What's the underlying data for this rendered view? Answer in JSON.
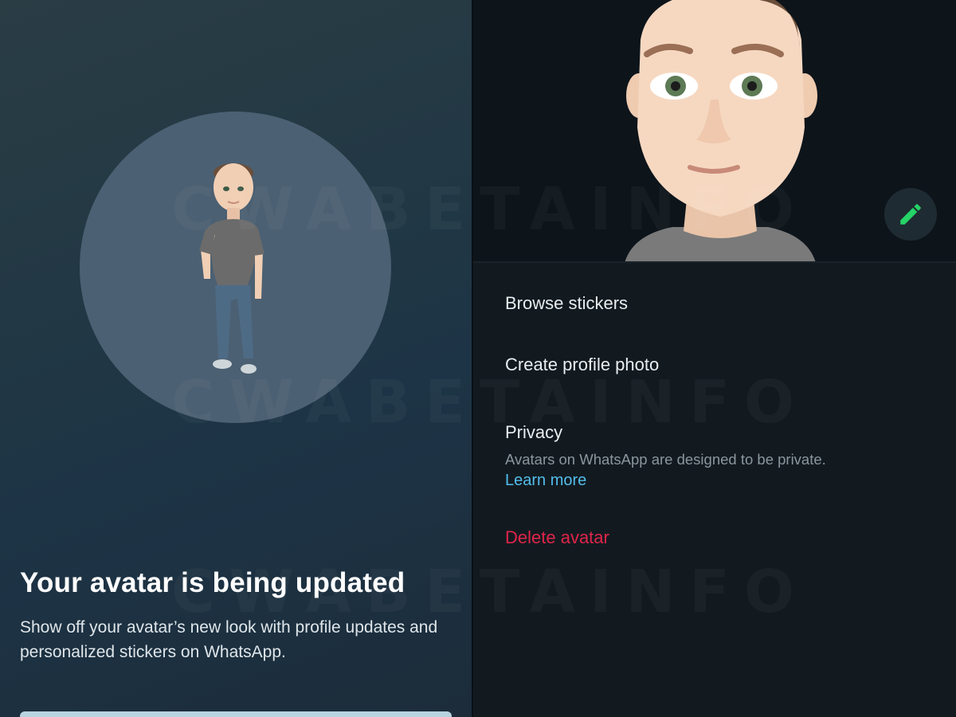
{
  "status": {
    "title": "Your avatar is being updated",
    "body": "Show off your avatar’s new look with profile updates and personalized stickers on WhatsApp."
  },
  "menu": {
    "browse_stickers": "Browse stickers",
    "create_profile_photo": "Create profile photo",
    "privacy": {
      "title": "Privacy",
      "description": "Avatars on WhatsApp are designed to be private.",
      "link": "Learn more"
    },
    "delete_avatar": "Delete avatar"
  },
  "watermark": "CWABETAINFO",
  "icons": {
    "edit": "pencil-icon"
  },
  "colors": {
    "accent_green": "#25d366",
    "link_blue": "#53bdeb",
    "danger_red": "#e0244a",
    "panel_dark": "#121a20"
  }
}
